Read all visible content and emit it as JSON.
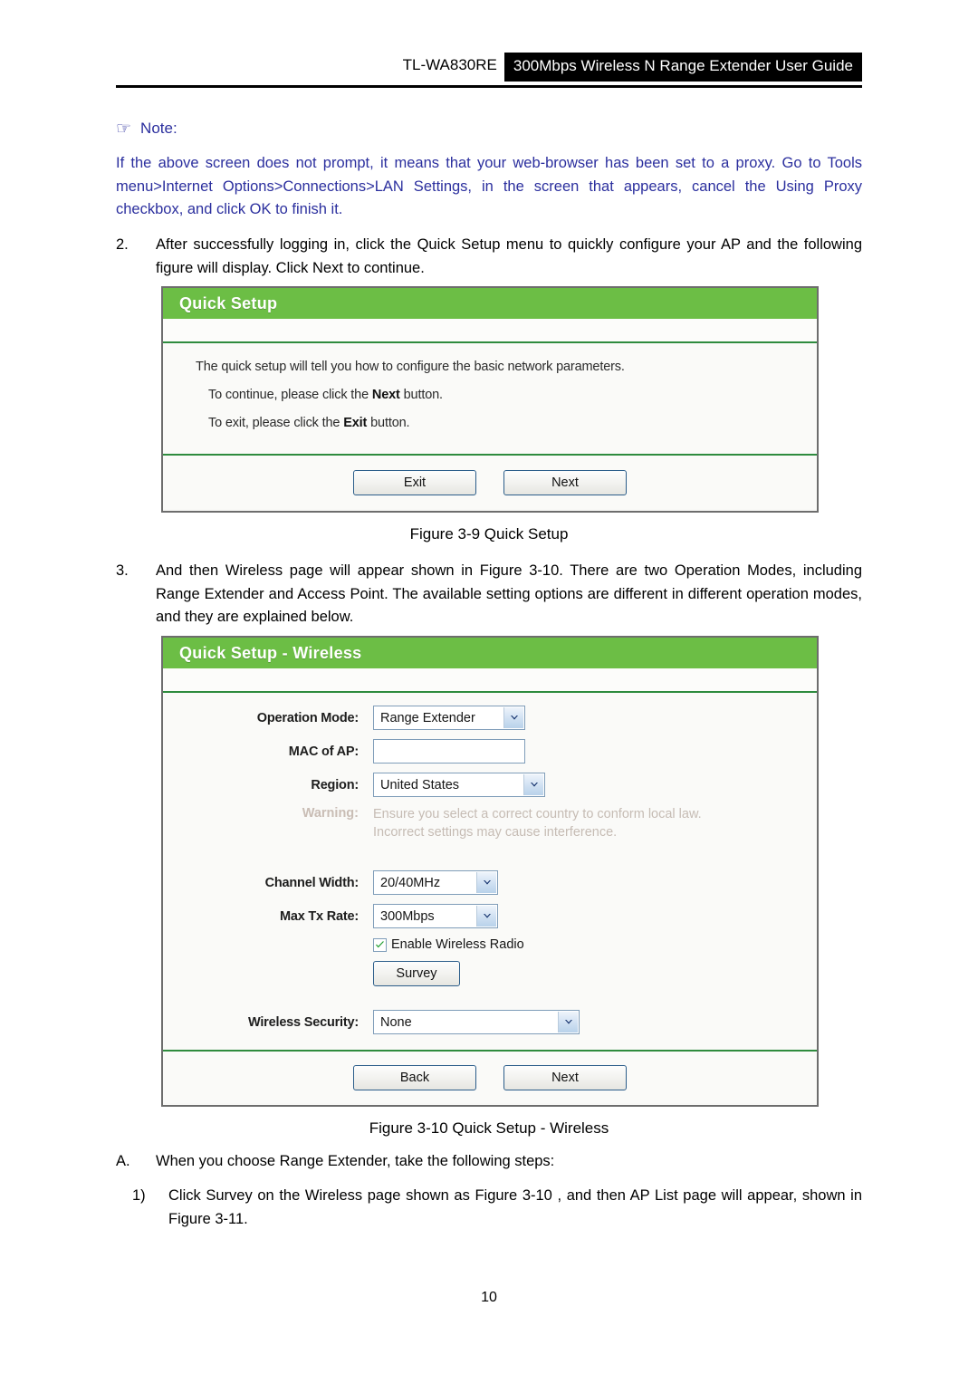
{
  "header": {
    "model": "TL-WA830RE",
    "title": "300Mbps Wireless N Range Extender User Guide"
  },
  "note": {
    "hand_icon": "pointing-hand-icon",
    "hand_glyph": "☞",
    "label": "Note:",
    "body": "If the above screen does not prompt, it means that your web-browser has been set to a proxy. Go to Tools menu>Internet Options>Connections>LAN Settings, in the screen that appears, cancel the Using Proxy checkbox, and click OK to finish it.",
    "color": "#2b2f9e"
  },
  "steps": {
    "step2_marker": "2.",
    "step2_text": "After successfully logging in, click the Quick Setup menu to quickly configure your AP and the following figure will display. Click Next to continue.",
    "step3_marker": "3.",
    "step3_text": "And then Wireless page will appear shown in Figure 3-10. There are two Operation Modes, including Range Extender and Access Point. The available setting options are different in different operation modes, and they are explained below.",
    "stepA_marker": "A.",
    "stepA_text": "When you choose Range Extender, take the following steps:",
    "stepA1_marker": "1)",
    "stepA1_text": "Click Survey on the Wireless page shown as Figure 3-10 , and then AP List page will appear, shown in Figure 3-11."
  },
  "quick_setup_panel": {
    "title": "Quick Setup",
    "line1": "The quick setup will tell you how to configure the basic network parameters.",
    "line2_pre": "To continue, please click the ",
    "line2_bold": "Next",
    "line2_post": " button.",
    "line3_pre": "To exit, please click the ",
    "line3_bold": "Exit",
    "line3_post": "  button.",
    "exit_button": "Exit",
    "next_button": "Next"
  },
  "wireless_panel": {
    "title": "Quick Setup - Wireless",
    "operation_mode_label": "Operation Mode:",
    "operation_mode_value": "Range Extender",
    "mac_of_ap_label": "MAC of AP:",
    "mac_of_ap_value": "",
    "region_label": "Region:",
    "region_value": "United States",
    "warning_label": "Warning:",
    "warning_line1": "Ensure you select a correct country to conform local law.",
    "warning_line2": "Incorrect settings may cause interference.",
    "channel_width_label": "Channel Width:",
    "channel_width_value": "20/40MHz",
    "max_tx_rate_label": "Max Tx Rate:",
    "max_tx_rate_value": "300Mbps",
    "enable_radio_label": "Enable Wireless Radio",
    "enable_radio_checked": true,
    "survey_button": "Survey",
    "wireless_security_label": "Wireless Security:",
    "wireless_security_value": "None",
    "back_button": "Back",
    "next_button": "Next"
  },
  "captions": {
    "fig_3_9": "Figure 3-9 Quick Setup",
    "fig_3_10": "Figure 3-10 Quick Setup - Wireless"
  },
  "page_number": "10",
  "colors": {
    "brand_green": "#6cbe45",
    "separator_green": "#2e8b3e",
    "note_blue": "#2b2f9e",
    "warning_gray": "#c6bcb4",
    "control_border": "#7f9db9"
  }
}
